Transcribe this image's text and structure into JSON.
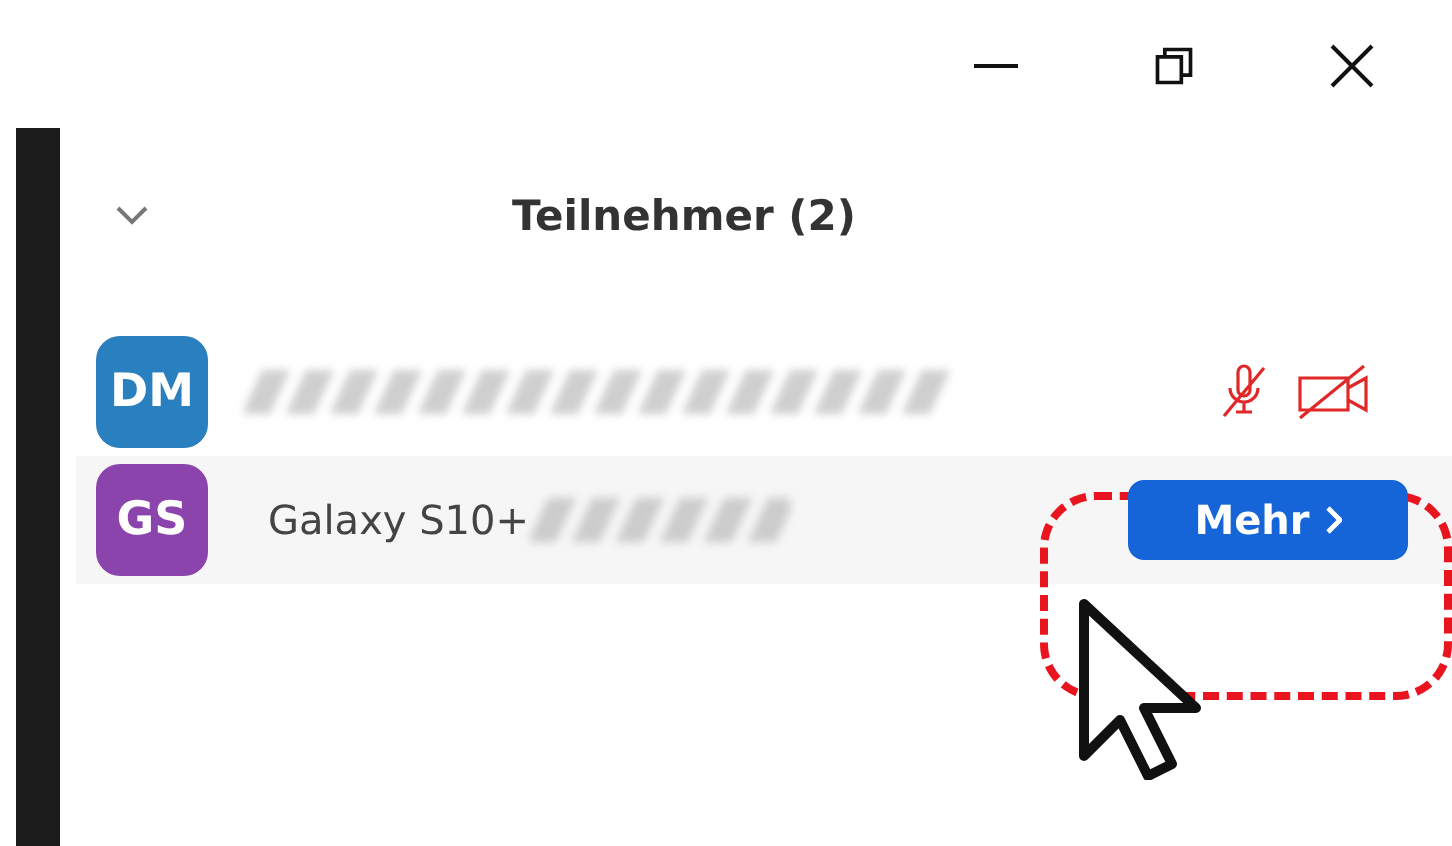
{
  "panel": {
    "title": "Teilnehmer (2)",
    "expanded": true
  },
  "participants": [
    {
      "initials": "DM",
      "color": "#2a7fbf",
      "name_blurred": true,
      "hovered": false,
      "audio_muted": true,
      "video_off": true
    },
    {
      "initials": "GS",
      "color": "#8c44ad",
      "name": "Galaxy S10+",
      "name_blurred": true,
      "hovered": true,
      "more_label": "Mehr"
    }
  ]
}
